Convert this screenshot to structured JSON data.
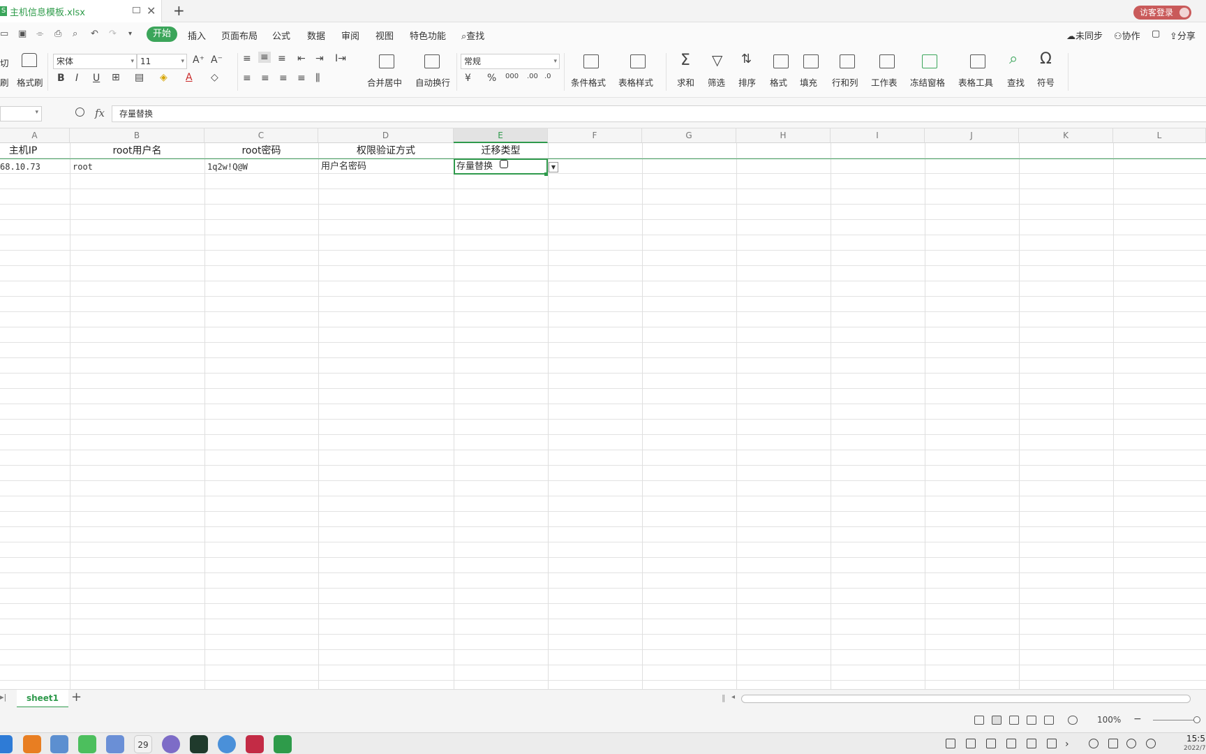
{
  "window": {
    "file_name": "主机信息模板.xlsx",
    "app_badge": "S",
    "guest_login": "访客登录"
  },
  "menubar": {
    "start": "开始",
    "items": [
      "插入",
      "页面布局",
      "公式",
      "数据",
      "审阅",
      "视图",
      "特色功能"
    ],
    "search": "查找",
    "sync": "未同步",
    "collab": "协作",
    "share": "分享"
  },
  "ribbon": {
    "cut_partial": "切",
    "cut_partial2": "刷",
    "format_painter": "格式刷",
    "font_name": "宋体",
    "font_size": "11",
    "merge_center": "合并居中",
    "wrap_text": "自动换行",
    "number_format": "常规",
    "conditional_format": "条件格式",
    "table_style": "表格样式",
    "sum": "求和",
    "filter": "筛选",
    "sort": "排序",
    "format": "格式",
    "fill": "填充",
    "row_col": "行和列",
    "worksheet": "工作表",
    "freeze": "冻结窗格",
    "table_tools": "表格工具",
    "find": "查找",
    "symbol": "符号"
  },
  "formula_bar": {
    "fx": "fx",
    "value": "存量替换"
  },
  "columns": [
    "A",
    "B",
    "C",
    "D",
    "E",
    "F",
    "G",
    "H",
    "I",
    "J",
    "K",
    "L"
  ],
  "rows": {
    "header": [
      "主机IP",
      "root用户名",
      "root密码",
      "权限验证方式",
      "迁移类型"
    ],
    "data": [
      "68.10.73",
      "root",
      "1q2w!Q@W",
      "用户名密码",
      "存量替换"
    ]
  },
  "sheets": {
    "active": "sheet1"
  },
  "status": {
    "zoom": "100%"
  },
  "taskbar": {
    "calendar_day": "29",
    "clock": "15:5",
    "date": "2022/7"
  }
}
